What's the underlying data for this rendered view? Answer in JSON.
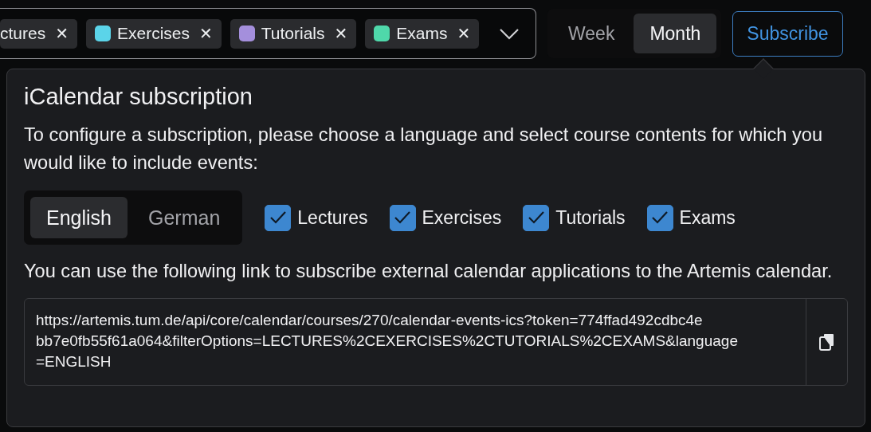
{
  "filters": [
    {
      "label": "ctures"
    },
    {
      "label": "Exercises",
      "color": "#5bd4e9"
    },
    {
      "label": "Tutorials",
      "color": "#a48fdc"
    },
    {
      "label": "Exams",
      "color": "#4fd8aa"
    }
  ],
  "remove_symbol": "✕",
  "views": [
    {
      "label": "Week",
      "selected": false
    },
    {
      "label": "Month",
      "selected": true
    }
  ],
  "subscribe_button": "Subscribe",
  "popover": {
    "title": "iCalendar subscription",
    "intro": "To configure a subscription, please choose a language and select course contents for which you would like to include events:",
    "languages": [
      {
        "label": "English",
        "selected": true
      },
      {
        "label": "German",
        "selected": false
      }
    ],
    "contents": [
      {
        "label": "Lectures",
        "checked": true
      },
      {
        "label": "Exercises",
        "checked": true
      },
      {
        "label": "Tutorials",
        "checked": true
      },
      {
        "label": "Exams",
        "checked": true
      }
    ],
    "link_text": "You can use the following link to subscribe external calendar applications to the Artemis calendar.",
    "url_lines": [
      "https://artemis.tum.de/api/core/calendar/courses/270/calendar-events-ics?token=774ffad492cdbc4e",
      "bb7e0fb55f61a064&filterOptions=LECTURES%2CEXERCISES%2CTUTORIALS%2CEXAMS&language",
      "=ENGLISH"
    ]
  }
}
